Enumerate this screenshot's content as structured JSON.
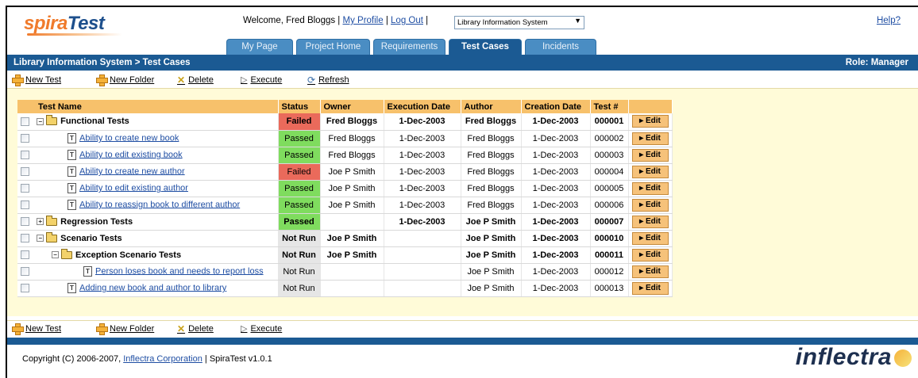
{
  "header": {
    "logo_part1": "spira",
    "logo_part2": "Test",
    "welcome_text": "Welcome, Fred Bloggs |",
    "my_profile_link": "My Profile",
    "separator": "|",
    "logout_link": "Log Out",
    "separator2": "|",
    "project_select_value": "Library Information System",
    "help_link": "Help?"
  },
  "tabs": [
    {
      "label": "My Page"
    },
    {
      "label": "Project Home"
    },
    {
      "label": "Requirements"
    },
    {
      "label": "Test Cases"
    },
    {
      "label": "Incidents"
    }
  ],
  "titlebar": {
    "breadcrumb": "Library Information System > Test Cases",
    "role": "Role: Manager"
  },
  "toolbar": {
    "new_test": "New Test",
    "new_folder": "New Folder",
    "delete": "Delete",
    "execute": "Execute",
    "refresh": "Refresh"
  },
  "table": {
    "headers": [
      "Test Name",
      "Status",
      "Owner",
      "Execution Date",
      "Author",
      "Creation Date",
      "Test #"
    ],
    "edit_label": "▸ Edit",
    "rows": [
      {
        "name": "Functional Tests",
        "status": "Failed",
        "owner": "Fred Bloggs",
        "exec": "1-Dec-2003",
        "author": "Fred Bloggs",
        "created": "1-Dec-2003",
        "id": "000001"
      },
      {
        "name": "Ability to create new book",
        "status": "Passed",
        "owner": "Fred Bloggs",
        "exec": "1-Dec-2003",
        "author": "Fred Bloggs",
        "created": "1-Dec-2003",
        "id": "000002"
      },
      {
        "name": "Ability to edit existing book",
        "status": "Passed",
        "owner": "Fred Bloggs",
        "exec": "1-Dec-2003",
        "author": "Fred Bloggs",
        "created": "1-Dec-2003",
        "id": "000003"
      },
      {
        "name": "Ability to create new author",
        "status": "Failed",
        "owner": "Joe P Smith",
        "exec": "1-Dec-2003",
        "author": "Fred Bloggs",
        "created": "1-Dec-2003",
        "id": "000004"
      },
      {
        "name": "Ability to edit existing author",
        "status": "Passed",
        "owner": "Joe P Smith",
        "exec": "1-Dec-2003",
        "author": "Fred Bloggs",
        "created": "1-Dec-2003",
        "id": "000005"
      },
      {
        "name": "Ability to reassign book to different author",
        "status": "Passed",
        "owner": "Joe P Smith",
        "exec": "1-Dec-2003",
        "author": "Fred Bloggs",
        "created": "1-Dec-2003",
        "id": "000006"
      },
      {
        "name": "Regression Tests",
        "status": "Passed",
        "owner": "",
        "exec": "1-Dec-2003",
        "author": "Joe P Smith",
        "created": "1-Dec-2003",
        "id": "000007"
      },
      {
        "name": "Scenario Tests",
        "status": "Not Run",
        "owner": "Joe P Smith",
        "exec": "",
        "author": "Joe P Smith",
        "created": "1-Dec-2003",
        "id": "000010"
      },
      {
        "name": "Exception Scenario Tests",
        "status": "Not Run",
        "owner": "Joe P Smith",
        "exec": "",
        "author": "Joe P Smith",
        "created": "1-Dec-2003",
        "id": "000011"
      },
      {
        "name": "Person loses book and needs to report loss",
        "status": "Not Run",
        "owner": "",
        "exec": "",
        "author": "Joe P Smith",
        "created": "1-Dec-2003",
        "id": "000012"
      },
      {
        "name": "Adding new book and author to library",
        "status": "Not Run",
        "owner": "",
        "exec": "",
        "author": "Joe P Smith",
        "created": "1-Dec-2003",
        "id": "000013"
      }
    ]
  },
  "footer": {
    "copyright": "Copyright (C) 2006-2007,",
    "company_link": "Inflectra Corporation",
    "version": "| SpiraTest v1.0.1",
    "brand": "inflectra"
  },
  "colors": {
    "accent_blue": "#1b5a93",
    "tab_blue": "#4a8dc3",
    "failed": "#ea6a5b",
    "passed": "#7fdc5e",
    "header_orange": "#f7c16b",
    "content_bg": "#fffbd8"
  }
}
